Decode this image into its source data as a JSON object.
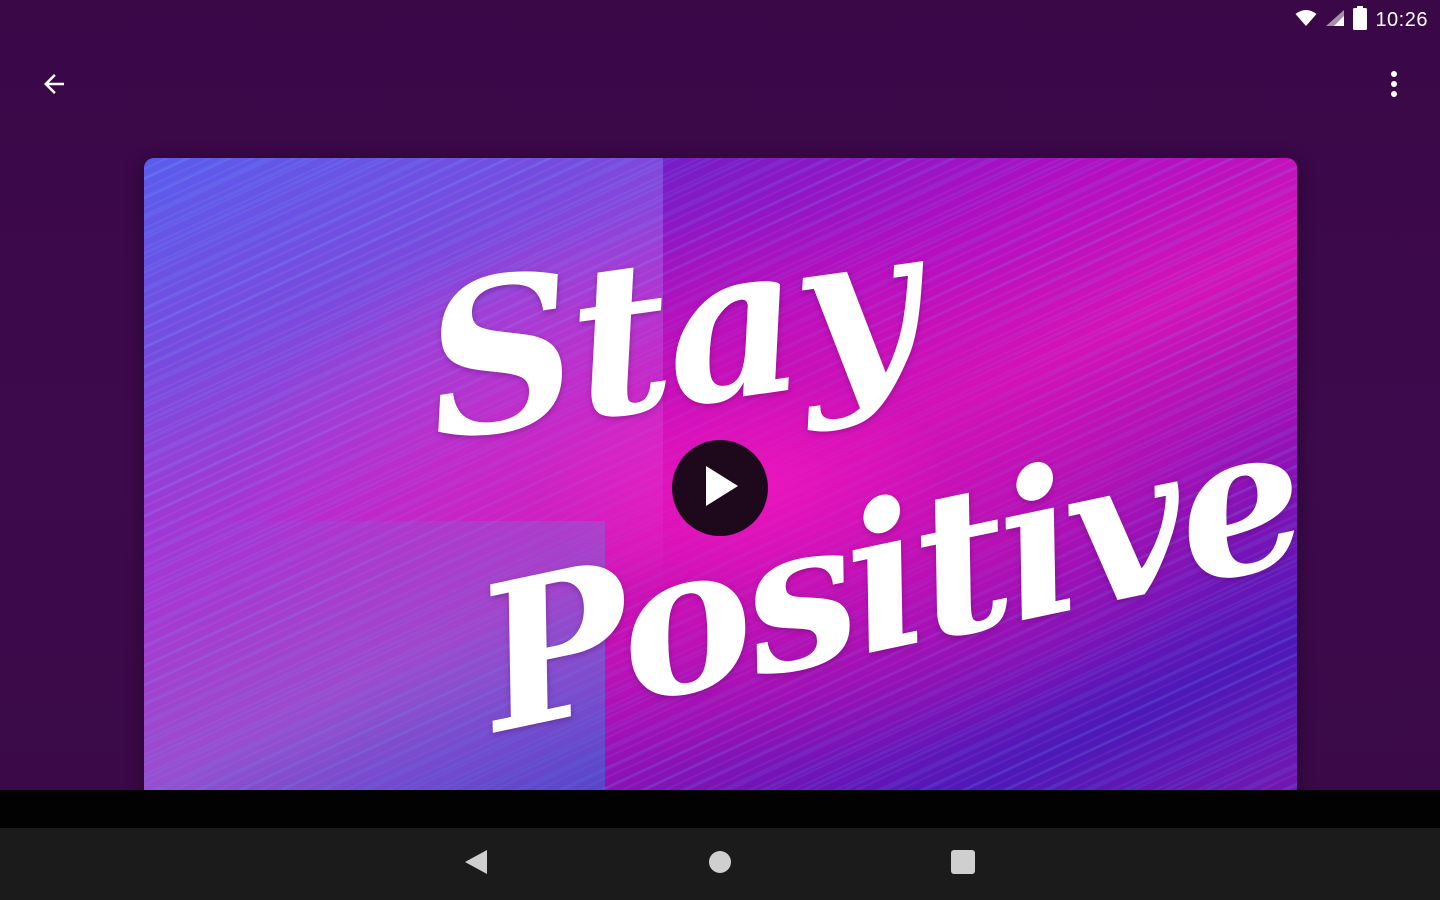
{
  "status_bar": {
    "time": "10:26",
    "icons": [
      "wifi-icon",
      "signal-icon",
      "battery-icon"
    ]
  },
  "app_bar": {
    "back_icon": "arrow-left-icon",
    "more_icon": "more-vertical-icon"
  },
  "video": {
    "thumbnail_text_line_1": "Stay",
    "thumbnail_text_line_2": "Positive",
    "play_icon": "play-icon"
  },
  "nav_bar": {
    "icons": [
      "back-triangle-icon",
      "home-circle-icon",
      "recents-square-icon"
    ]
  },
  "colors": {
    "background": "#3a0846",
    "nav_bar": "#1b1b1b",
    "accent_pink": "#d214b8",
    "accent_blue": "#4a2ad6"
  }
}
